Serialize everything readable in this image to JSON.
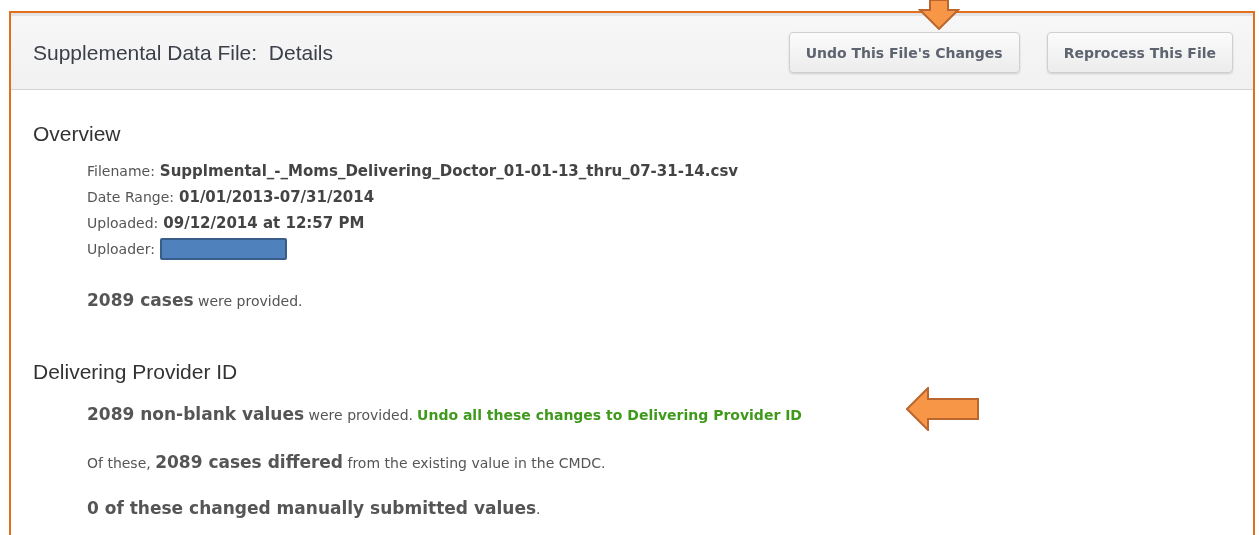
{
  "header": {
    "title": "Supplemental Data File:  Details",
    "buttons": [
      {
        "label": "Undo This File's Changes"
      },
      {
        "label": "Reprocess This File"
      }
    ]
  },
  "overview": {
    "heading": "Overview",
    "details": [
      {
        "label": "Filename:",
        "value": "Supplmental_-_Moms_Delivering_Doctor_01-01-13_thru_07-31-14.csv"
      },
      {
        "label": "Date Range:",
        "value": "01/01/2013-07/31/2014"
      },
      {
        "label": "Uploaded:",
        "value": "09/12/2014 at 12:57 PM"
      },
      {
        "label": "Uploader:",
        "redacted": true
      }
    ],
    "summary": "**2089 cases** were provided."
  },
  "field_section": {
    "heading": "Delivering Provider ID",
    "provided": "**2089 non-blank values** were provided.",
    "undo_link": "Undo all these changes to Delivering Provider ID",
    "differed": "Of these, **2089 cases differed** from the existing value in the CMDC.",
    "manual": "**0 of these changed manually submitted values**."
  }
}
